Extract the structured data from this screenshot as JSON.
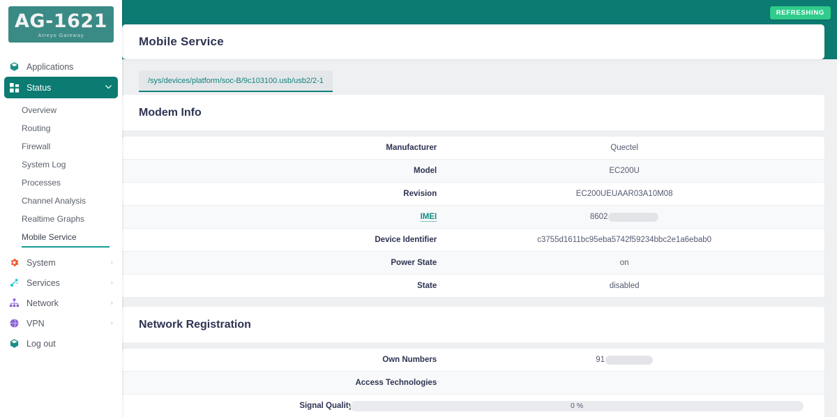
{
  "brand": {
    "logo_title": "AG-1621",
    "logo_subtitle": "Atreyo Gateway",
    "logo_bg": "#3a8a85"
  },
  "topbar": {
    "refresh_badge": "REFRESHING",
    "badge_color": "#2fcc8b",
    "bar_color": "#0c7b72"
  },
  "header": {
    "page_title": "Mobile Service"
  },
  "tabs": [
    {
      "label": "/sys/devices/platform/soc-B/9c103100.usb/usb2/2-1",
      "active": true
    }
  ],
  "sidebar": {
    "items": [
      {
        "label": "Applications",
        "icon": "cube-icon",
        "icon_color": "#1a8f86",
        "expandable": false,
        "active": false
      },
      {
        "label": "Status",
        "icon": "grid-icon",
        "icon_color": "#ffffff",
        "expandable": true,
        "active": true,
        "chevron": "∨"
      },
      {
        "label": "System",
        "icon": "gear-icon",
        "icon_color": "#f2542d",
        "expandable": true,
        "active": false,
        "chevron": "›"
      },
      {
        "label": "Services",
        "icon": "services-icon",
        "icon_color": "#24c6dd",
        "expandable": true,
        "active": false,
        "chevron": "›"
      },
      {
        "label": "Network",
        "icon": "network-icon",
        "icon_color": "#8b63d6",
        "expandable": true,
        "active": false,
        "chevron": "›"
      },
      {
        "label": "VPN",
        "icon": "globe-icon",
        "icon_color": "#8b63d6",
        "expandable": true,
        "active": false,
        "chevron": "›"
      },
      {
        "label": "Log out",
        "icon": "cube-icon",
        "icon_color": "#1a8f86",
        "expandable": false,
        "active": false
      }
    ],
    "status_submenu": [
      {
        "label": "Overview",
        "selected": false
      },
      {
        "label": "Routing",
        "selected": false
      },
      {
        "label": "Firewall",
        "selected": false
      },
      {
        "label": "System Log",
        "selected": false
      },
      {
        "label": "Processes",
        "selected": false
      },
      {
        "label": "Channel Analysis",
        "selected": false
      },
      {
        "label": "Realtime Graphs",
        "selected": false
      },
      {
        "label": "Mobile Service",
        "selected": true
      }
    ],
    "accent_color": "#0c7b72"
  },
  "sections": [
    {
      "title": "Modem Info",
      "rows": [
        {
          "key": "Manufacturer",
          "value": "Quectel",
          "type": "text"
        },
        {
          "key": "Model",
          "value": "EC200U",
          "type": "text"
        },
        {
          "key": "Revision",
          "value": "EC200UEUAAR03A10M08",
          "type": "text"
        },
        {
          "key": "IMEI",
          "value": "8602",
          "type": "redacted",
          "key_is_link": true
        },
        {
          "key": "Device Identifier",
          "value": "c3755d1611bc95eba5742f59234bbc2e1a6ebab0",
          "type": "text"
        },
        {
          "key": "Power State",
          "value": "on",
          "type": "text"
        },
        {
          "key": "State",
          "value": "disabled",
          "type": "text"
        }
      ]
    },
    {
      "title": "Network Registration",
      "rows": [
        {
          "key": "Own Numbers",
          "value": "91",
          "type": "redacted"
        },
        {
          "key": "Access Technologies",
          "value": "",
          "type": "text"
        },
        {
          "key": "Signal Quality",
          "value": "0 %",
          "type": "progress",
          "percent": 0
        }
      ]
    }
  ]
}
